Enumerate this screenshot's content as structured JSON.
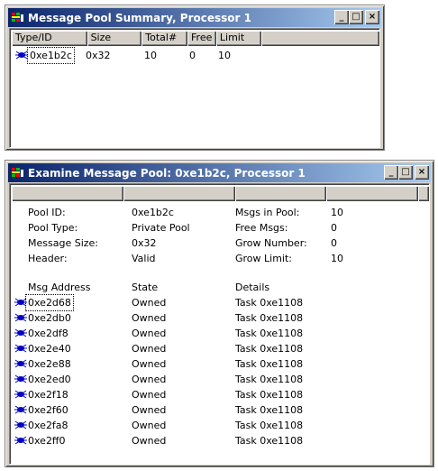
{
  "colors": {
    "title_active": "#0a246a",
    "title_gradient_end": "#a6caf0",
    "face": "#d4d0c8"
  },
  "window1": {
    "title": "Message Pool Summary, Processor 1",
    "buttons": {
      "minimize": "_",
      "maximize": "□",
      "close": "×"
    },
    "columns": [
      "Type/ID",
      "Size",
      "Total#",
      "Free",
      "Limit"
    ],
    "rows": [
      {
        "type_id": "0xe1b2c",
        "size": "0x32",
        "total": "10",
        "free": "0",
        "limit": "10"
      }
    ]
  },
  "window2": {
    "title": "Examine Message Pool: 0xe1b2c, Processor 1",
    "buttons": {
      "minimize": "_",
      "maximize": "□",
      "close": "×"
    },
    "info": {
      "pool_id_label": "Pool ID:",
      "pool_id": "0xe1b2c",
      "pool_type_label": "Pool Type:",
      "pool_type": "Private Pool",
      "message_size_label": "Message Size:",
      "message_size": "0x32",
      "header_label": "Header:",
      "header": "Valid",
      "msgs_in_pool_label": "Msgs in Pool:",
      "msgs_in_pool": "10",
      "free_msgs_label": "Free Msgs:",
      "free_msgs": "0",
      "grow_number_label": "Grow Number:",
      "grow_number": "0",
      "grow_limit_label": "Grow Limit:",
      "grow_limit": "10"
    },
    "list_headers": {
      "address": "Msg Address",
      "state": "State",
      "details": "Details"
    },
    "messages": [
      {
        "address": "0xe2d68",
        "state": "Owned",
        "details": "Task 0xe1108"
      },
      {
        "address": "0xe2db0",
        "state": "Owned",
        "details": "Task 0xe1108"
      },
      {
        "address": "0xe2df8",
        "state": "Owned",
        "details": "Task 0xe1108"
      },
      {
        "address": "0xe2e40",
        "state": "Owned",
        "details": "Task 0xe1108"
      },
      {
        "address": "0xe2e88",
        "state": "Owned",
        "details": "Task 0xe1108"
      },
      {
        "address": "0xe2ed0",
        "state": "Owned",
        "details": "Task 0xe1108"
      },
      {
        "address": "0xe2f18",
        "state": "Owned",
        "details": "Task 0xe1108"
      },
      {
        "address": "0xe2f60",
        "state": "Owned",
        "details": "Task 0xe1108"
      },
      {
        "address": "0xe2fa8",
        "state": "Owned",
        "details": "Task 0xe1108"
      },
      {
        "address": "0xe2ff0",
        "state": "Owned",
        "details": "Task 0xe1108"
      }
    ]
  }
}
